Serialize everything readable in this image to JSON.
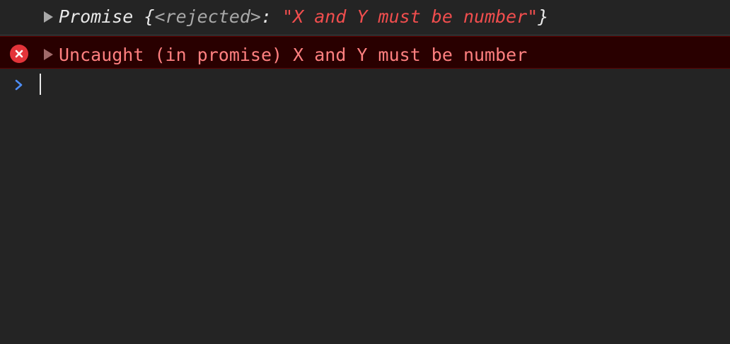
{
  "promise_row": {
    "label": "Promise",
    "brace_open": " {",
    "state_key": "<rejected>",
    "colon": ": ",
    "value": "\"X and Y must be number\"",
    "brace_close": "}",
    "expand_icon": "triangle-right-icon"
  },
  "error_row": {
    "icon": "error-circle-x-icon",
    "message": "Uncaught (in promise) X and Y must be number",
    "expand_icon": "triangle-right-icon"
  },
  "prompt": {
    "icon": "chevron-right-prompt-icon",
    "value": ""
  },
  "colors": {
    "background": "#242424",
    "error_background": "#290000",
    "error_text": "#ff8080",
    "string_red": "#f14e4e",
    "prompt_blue": "#4d8df5",
    "error_icon": "#e3343a"
  }
}
